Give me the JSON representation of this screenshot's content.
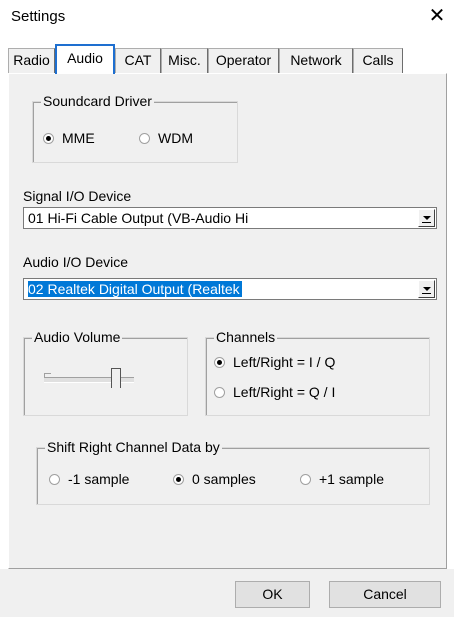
{
  "window": {
    "title": "Settings",
    "close_glyph": "✕"
  },
  "tabs": [
    "Radio",
    "Audio",
    "CAT",
    "Misc.",
    "Operator",
    "Network",
    "Calls"
  ],
  "active_tab": "Audio",
  "soundcard_driver": {
    "label": "Soundcard Driver",
    "options": [
      {
        "label": "MME",
        "checked": true
      },
      {
        "label": "WDM",
        "checked": false
      }
    ]
  },
  "signal_io": {
    "label": "Signal I/O Device",
    "value": "01  Hi-Fi Cable Output (VB-Audio Hi"
  },
  "audio_io": {
    "label": "Audio I/O Device",
    "value": "02  Realtek Digital Output (Realtek"
  },
  "audio_volume": {
    "label": "Audio Volume",
    "level": 0.8
  },
  "channels": {
    "label": "Channels",
    "options": [
      {
        "label": "Left/Right = I / Q",
        "checked": true
      },
      {
        "label": "Left/Right = Q / I",
        "checked": false
      }
    ]
  },
  "shift": {
    "label": "Shift Right Channel Data by",
    "options": [
      {
        "label": "-1 sample",
        "checked": false
      },
      {
        "label": "0 samples",
        "checked": true
      },
      {
        "label": "+1 sample",
        "checked": false
      }
    ]
  },
  "buttons": {
    "ok": "OK",
    "cancel": "Cancel"
  },
  "colors": {
    "accent": "#0078d7",
    "tab_focus": "#1e6fd0",
    "panel": "#f0f0f0"
  }
}
